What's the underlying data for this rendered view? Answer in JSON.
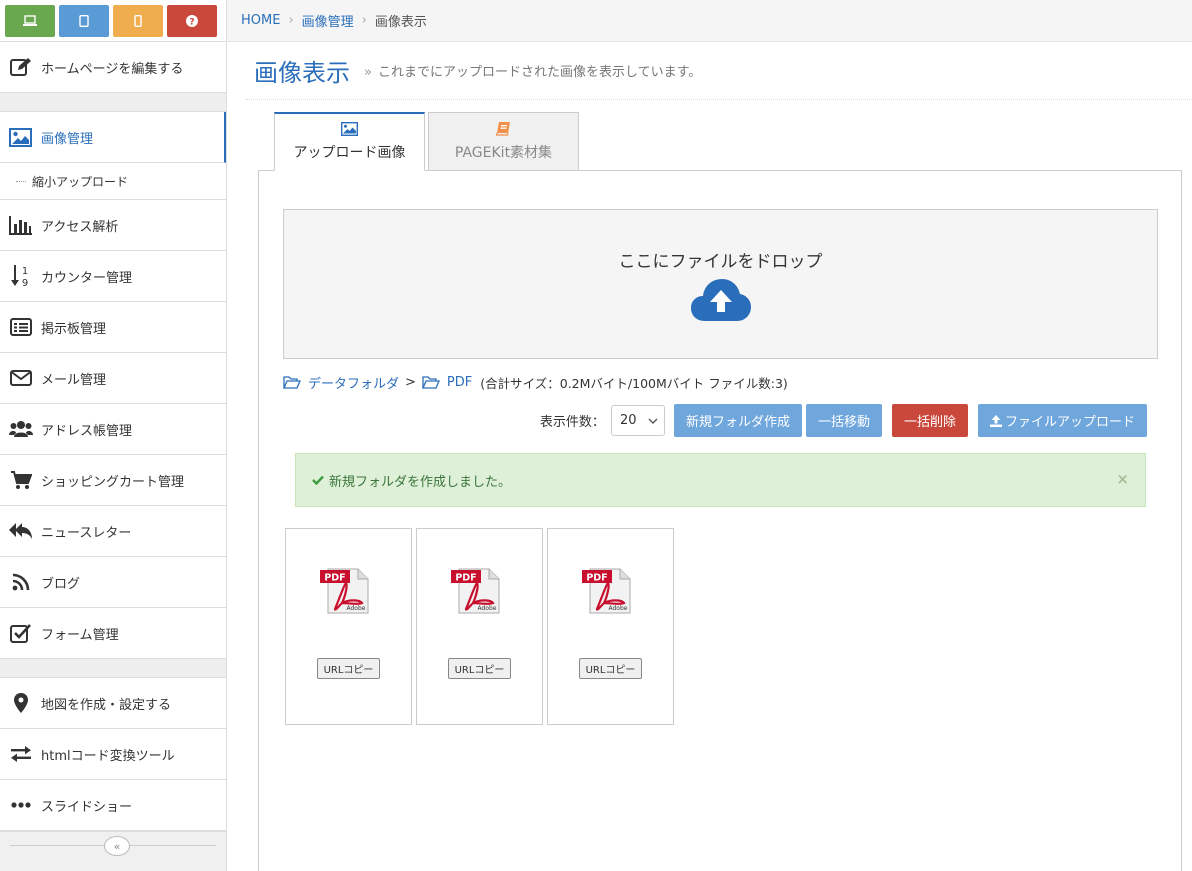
{
  "sidebar": {
    "top_buttons": [
      {
        "name": "desktop-view",
        "icon": "laptop-icon",
        "color": "#6aa84f"
      },
      {
        "name": "tablet-view",
        "icon": "tablet-icon",
        "color": "#5b9bd5"
      },
      {
        "name": "mobile-view",
        "icon": "mobile-icon",
        "color": "#f0ad4e"
      },
      {
        "name": "help",
        "icon": "question-icon",
        "color": "#c9473b"
      }
    ],
    "edit_home": "ホームページを編集する",
    "image_manage": "画像管理",
    "shrink_upload": "縮小アップロード",
    "items": [
      "アクセス解析",
      "カウンター管理",
      "掲示板管理",
      "メール管理",
      "アドレス帳管理",
      "ショッピングカート管理",
      "ニュースレター",
      "ブログ",
      "フォーム管理"
    ],
    "items2": [
      "地図を作成・設定する",
      "htmlコード変換ツール",
      "スライドショー"
    ],
    "collapse_label": "«"
  },
  "breadcrumb": {
    "home": "HOME",
    "level1": "画像管理",
    "current": "画像表示"
  },
  "page": {
    "title": "画像表示",
    "raquo": "»",
    "subtitle": "これまでにアップロードされた画像を表示しています。"
  },
  "tabs": [
    {
      "label": "アップロード画像",
      "active": true
    },
    {
      "label": "PAGEKit素材集",
      "active": false
    }
  ],
  "dropzone": {
    "text": "ここにファイルをドロップ"
  },
  "path": {
    "root": "データフォルダ",
    "gt": ">",
    "folder": "PDF",
    "info": "(合計サイズ：0.2Mバイト/100Mバイト ファイル数:3)"
  },
  "toolbar": {
    "per_page_label": "表示件数：",
    "per_page_value": "20",
    "new_folder": "新規フォルダ作成",
    "bulk_move": "一括移動",
    "bulk_delete": "一括削除",
    "upload": "ファイルアップロード"
  },
  "alert": {
    "message": "新規フォルダを作成しました。",
    "close": "×"
  },
  "files": [
    {
      "type": "pdf",
      "copy_label": "URLコピー"
    },
    {
      "type": "pdf",
      "copy_label": "URLコピー"
    },
    {
      "type": "pdf",
      "copy_label": "URLコピー"
    }
  ],
  "pdf_icon": {
    "badge": "PDF",
    "brand": "Adobe"
  },
  "colors": {
    "accent": "#2a6ebb",
    "button_blue": "#6fa6dc",
    "button_red": "#c9473b",
    "alert_bg": "#dff0d8"
  }
}
